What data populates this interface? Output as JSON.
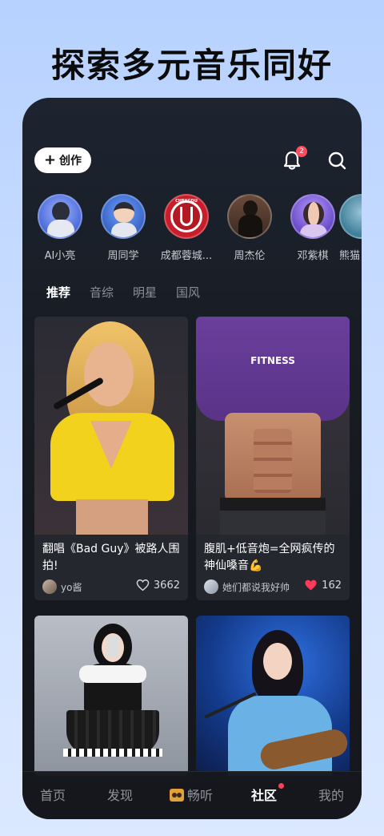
{
  "headline": "探索多元音乐同好",
  "topbar": {
    "create_label": "创作",
    "notification_count": "2"
  },
  "avatars": [
    {
      "label": "AI小亮",
      "icon": "avatar-ai-xiaoliang"
    },
    {
      "label": "周同学",
      "icon": "avatar-zhou-tongxue"
    },
    {
      "label": "成都蓉城...",
      "icon": "avatar-chengdu-rongcheng",
      "logo_text": "CHENGDU"
    },
    {
      "label": "周杰伦",
      "icon": "avatar-zhou-jielun"
    },
    {
      "label": "邓紫棋",
      "icon": "avatar-deng-ziqi"
    },
    {
      "label": "熊猫",
      "icon": "avatar-partial"
    }
  ],
  "tabs": [
    "推荐",
    "音综",
    "明星",
    "国风"
  ],
  "cards": [
    {
      "title": "翻唱《Bad Guy》被路人围拍!",
      "author": "yo酱",
      "likes": "3662",
      "liked": false
    },
    {
      "title": "腹肌+低音炮=全网疯传的神仙嗓音💪",
      "author": "她们都说我好帅",
      "likes": "162",
      "liked": true,
      "image_text": "FITNESS"
    },
    {
      "title": "",
      "author": "",
      "likes": ""
    },
    {
      "title": "",
      "author": "",
      "likes": ""
    }
  ],
  "nav": {
    "items": [
      "首页",
      "发现",
      "畅听",
      "社区",
      "我的"
    ],
    "active": "社区"
  },
  "colors": {
    "accent_red": "#ff4057",
    "phone_bg": "#171b22",
    "page_bg": "#cfe0ff"
  }
}
